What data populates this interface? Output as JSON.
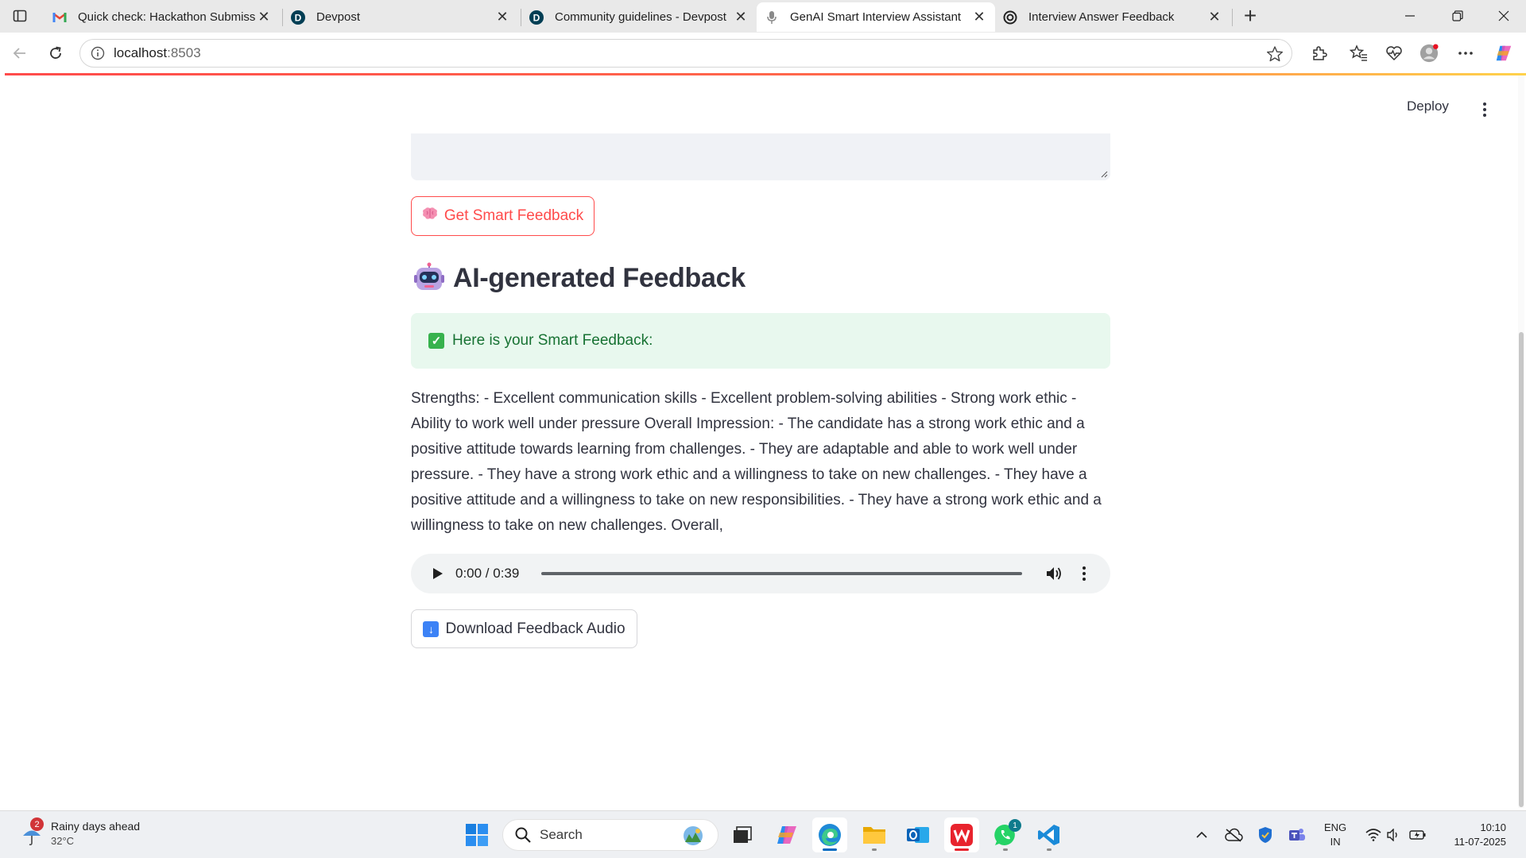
{
  "browser": {
    "tabs": [
      {
        "title": "Quick check: Hackathon Submissi",
        "icon": "gmail-icon"
      },
      {
        "title": "Devpost",
        "icon": "devpost-icon"
      },
      {
        "title": "Community guidelines - Devpost",
        "icon": "devpost-icon"
      },
      {
        "title": "GenAI Smart Interview Assistant",
        "icon": "microphone-icon"
      },
      {
        "title": "Interview Answer Feedback",
        "icon": "openai-icon"
      }
    ],
    "active_tab_index": 3,
    "url_host": "localhost",
    "url_port": ":8503"
  },
  "app": {
    "deploy_label": "Deploy",
    "get_feedback_button": "Get Smart Feedback",
    "section_heading": "AI-generated Feedback",
    "success_message": "Here is your Smart Feedback:",
    "feedback_text": "Strengths: - Excellent communication skills - Excellent problem-solving abilities - Strong work ethic - Ability to work well under pressure Overall Impression: - The candidate has a strong work ethic and a positive attitude towards learning from challenges. - They are adaptable and able to work well under pressure. - They have a strong work ethic and a willingness to take on new challenges. - They have a positive attitude and a willingness to take on new responsibilities. - They have a strong work ethic and a willingness to take on new challenges. Overall,",
    "audio": {
      "time": "0:00 / 0:39",
      "progress": 0
    },
    "download_button": "Download Feedback Audio",
    "accent_color": "#ff4b4b",
    "success_color": "#177233"
  },
  "taskbar": {
    "weather_title": "Rainy days ahead",
    "weather_temp": "32°C",
    "weather_badge": "2",
    "search_placeholder": "Search",
    "whatsapp_badge": "1",
    "lang_line1": "ENG",
    "lang_line2": "IN",
    "time": "10:10",
    "date": "11-07-2025"
  }
}
